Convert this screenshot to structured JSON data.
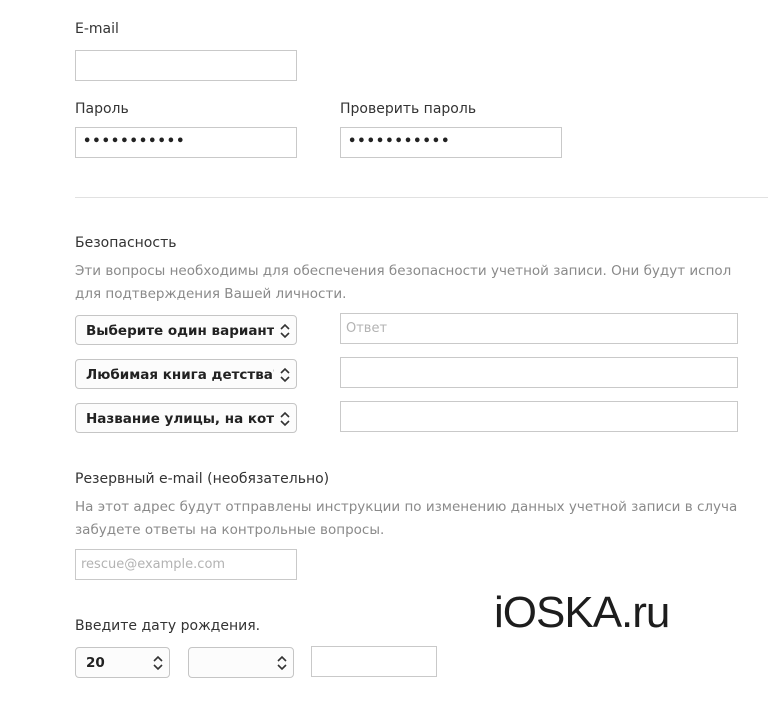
{
  "account": {
    "email_label": "E-mail",
    "email_value": "",
    "password_label": "Пароль",
    "password_value": "•••••••••••",
    "confirm_label": "Проверить пароль",
    "confirm_value": "•••••••••••"
  },
  "security": {
    "title": "Безопасность",
    "description_line1": "Эти вопросы необходимы для обеспечения безопасности учетной записи. Они будут испол",
    "description_line2": "для подтверждения Вашей личности.",
    "questions": [
      {
        "question": "Выберите один вариант.",
        "answer": "",
        "answer_placeholder": "Ответ"
      },
      {
        "question": "Любимая книга детства?",
        "answer": ""
      },
      {
        "question": "Название улицы, на котс",
        "answer": ""
      }
    ]
  },
  "rescue": {
    "title": "Резервный e-mail (необязательно)",
    "description_line1": "На этот адрес будут отправлены инструкции по изменению данных учетной записи в случа",
    "description_line2": "забудете ответы на контрольные вопросы.",
    "placeholder": "rescue@example.com"
  },
  "birthday": {
    "label": "Введите дату рождения.",
    "day": "20",
    "month": "",
    "year": ""
  },
  "watermark": "iOSKA.ru",
  "icons": {
    "select_arrows": "chevron-updown-icon"
  }
}
